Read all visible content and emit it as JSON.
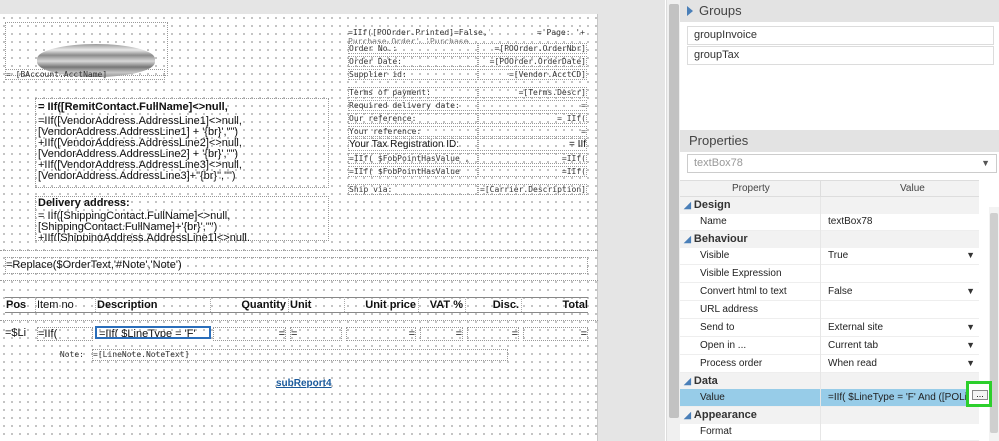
{
  "report": {
    "acct_name": "= [BAccount.AcctName]",
    "remit_name": "= IIf([RemitContact.FullName]<>null,",
    "address_lines": [
      "=IIf([VendorAddress.AddressLine1]<>null,",
      "[VendorAddress.AddressLine1] + '{br}',\"\")",
      "+IIf([VendorAddress.AddressLine2]<>null,",
      "[VendorAddress.AddressLine2] + '{br}',\"\")",
      "+IIf([VendorAddress.AddressLine3]<>null,",
      "[VendorAddress.AddressLine3]+\"{br}\",\"\")"
    ],
    "delivery_label": "Delivery address:",
    "delivery_lines": [
      "= IIf([ShippingContact.FullName]<>null,",
      "[ShippingContact.FullName]+'{br}',\"\")",
      "+IIf([ShippingAddress.AddressLine1]<>null,"
    ],
    "printed_expr": "=IIf([POOrder.Printed]=False,'",
    "printed_expr2": "Purchase Order','Purchase",
    "page_expr": "='Page: '+",
    "order_no_label": "Order No.:",
    "order_no_val": "=[POOrder.OrderNbr]",
    "order_date_label": "Order Date:",
    "order_date_val": "=[POOrder.OrderDate]",
    "supplier_label": "Supplier id:",
    "supplier_val": "=[Vendor.AcctCD]",
    "terms_label": "Terms of payment:",
    "terms_val": "=[Terms.Descr]",
    "req_delivery_label": "Required delivery date:",
    "req_delivery_val": "=",
    "our_ref_label": "Our reference:",
    "our_ref_val": "= IIf(",
    "your_ref_label": "Your reference:",
    "your_ref_val": "=",
    "tax_label": "Your Tax Registration ID:",
    "tax_val": "= IIf",
    "fob1_label": "=IIf( $FobPointHasValue ,",
    "fob1_val": "=IIf(",
    "fob2_label": "=IIf( $FobPointHasValue",
    "fob2_val": "=IIf(",
    "ship_label": "Ship via:",
    "ship_val": "=[Carrier.Description]",
    "order_text": "=Replace($OrderText,'#Note','Note')",
    "columns": [
      "Pos",
      "Item no",
      "Description",
      "Quantity",
      "Unit",
      "Unit price",
      "VAT %",
      "Disc.",
      "Total"
    ],
    "row_pos": "=$Li",
    "row_item": "=IIf(",
    "row_desc": "=IIf( $LineType = 'F'",
    "row_cells": [
      "=",
      "=",
      "=",
      "=",
      "=",
      "="
    ],
    "note_label": "Note:",
    "note_val": "=[LineNote.NoteText]",
    "subreport": "subReport4"
  },
  "groups": {
    "title": "Groups",
    "items": [
      "groupInvoice",
      "groupTax"
    ]
  },
  "properties": {
    "title": "Properties",
    "selected_object": "textBox78",
    "col_property": "Property",
    "col_value": "Value",
    "categories": {
      "design": "Design",
      "behaviour": "Behaviour",
      "data": "Data",
      "appearance": "Appearance"
    },
    "design_rows": [
      {
        "name": "Name",
        "value": "textBox78"
      }
    ],
    "behaviour_rows": [
      {
        "name": "Visible",
        "value": "True",
        "dropdown": true
      },
      {
        "name": "Visible Expression",
        "value": ""
      },
      {
        "name": "Convert html to text",
        "value": "False",
        "dropdown": true
      },
      {
        "name": "URL address",
        "value": ""
      },
      {
        "name": "Send to",
        "value": "External site",
        "dropdown": true
      },
      {
        "name": "Open in ...",
        "value": "Current tab",
        "dropdown": true
      },
      {
        "name": "Process order",
        "value": "When read",
        "dropdown": true
      }
    ],
    "data_rows": [
      {
        "name": "Value",
        "value": "=IIf( $LineType = 'F' And ([POLine"
      }
    ],
    "appearance_rows": [
      {
        "name": "Format",
        "value": ""
      }
    ]
  },
  "colors": {
    "selected_row": "#97cce8",
    "highlight": "#2ccf2c",
    "link": "#1a5a9c",
    "selection_border": "#2a6ebb"
  }
}
